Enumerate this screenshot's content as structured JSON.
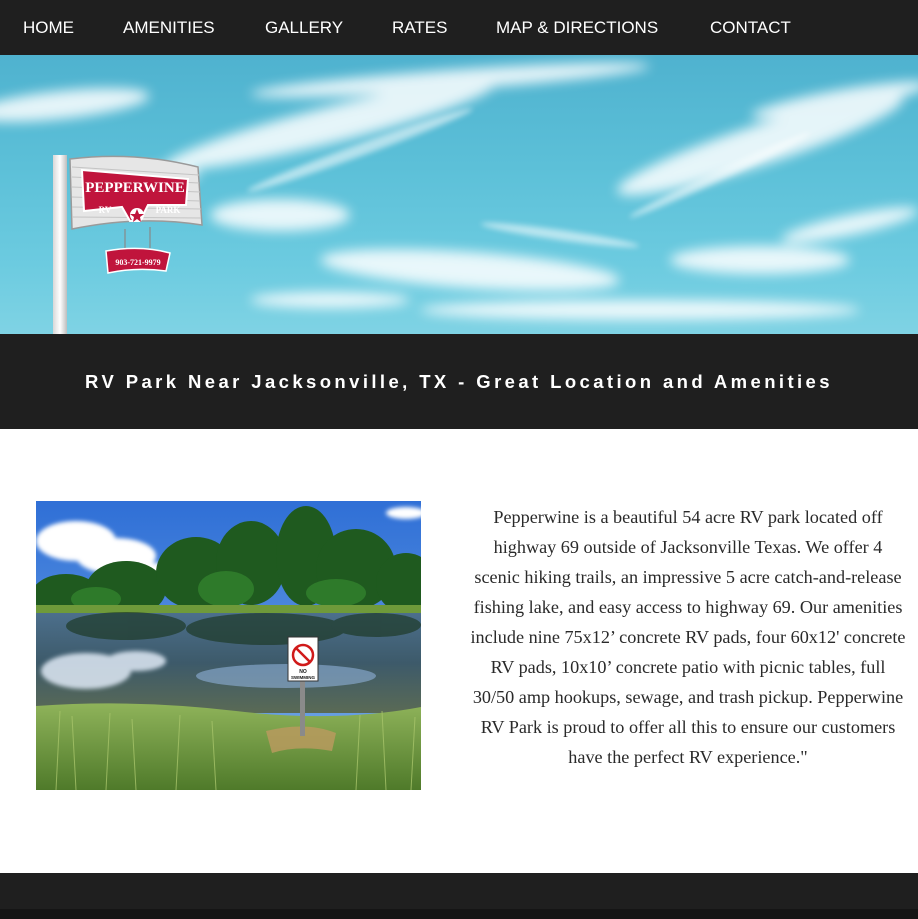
{
  "nav": {
    "items": [
      {
        "label": "HOME"
      },
      {
        "label": "AMENITIES"
      },
      {
        "label": "GALLERY"
      },
      {
        "label": "RATES"
      },
      {
        "label": "MAP & DIRECTIONS"
      },
      {
        "label": "CONTACT"
      }
    ]
  },
  "hero": {
    "sign_name": "PEPPERWINE",
    "sign_left": "RV",
    "sign_right": "PARK",
    "sign_phone": "903-721-9979"
  },
  "page_title": "RV Park Near Jacksonville, TX - Great Location and Amenities",
  "photo": {
    "sign_line1": "NO",
    "sign_line2": "SWIMMING"
  },
  "description": "Pepperwine is a beautiful 54 acre RV park located off highway 69 outside of Jacksonville Texas. We offer 4 scenic hiking trails, an impressive 5 acre catch-and-release fishing lake, and easy access to highway 69. Our amenities include nine 75x12’ concrete RV pads, four 60x12' concrete RV pads, 10x10’ concrete patio with picnic tables, full 30/50 amp hookups, sewage, and trash pickup. Pepperwine RV Park is proud to offer all this to ensure our customers have the perfect RV experience.\"",
  "colors": {
    "nav_bg": "#1f1f1f",
    "sky": "#5cc0d8",
    "sign_red": "#c0143c"
  }
}
